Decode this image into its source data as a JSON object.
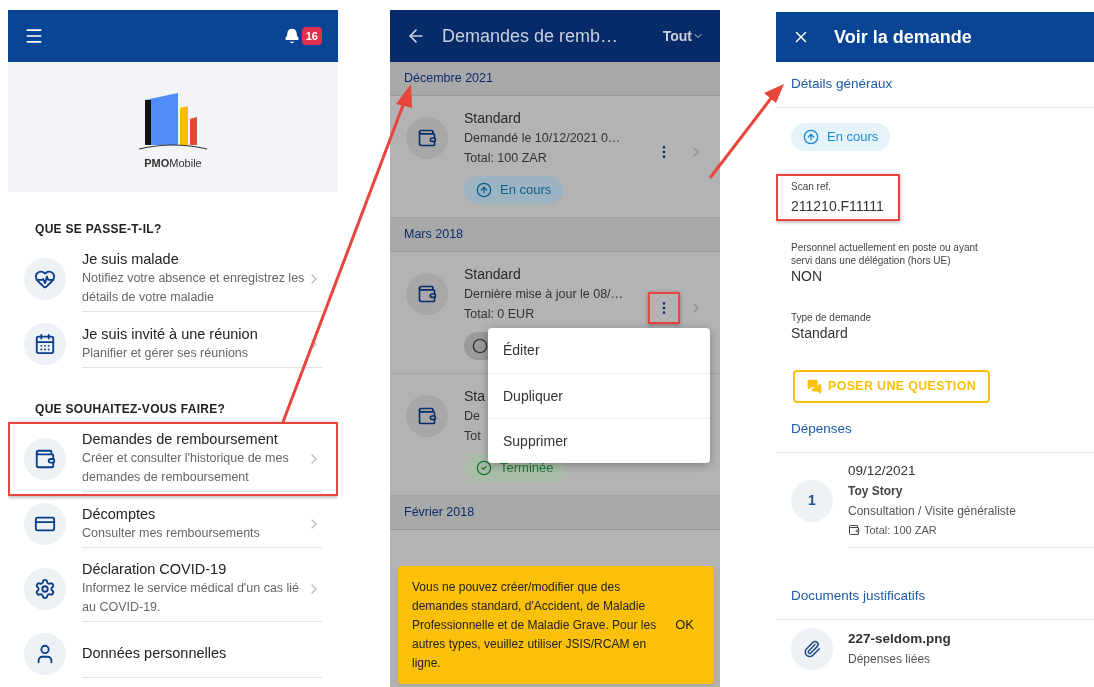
{
  "left_screen": {
    "notification_count": "16",
    "logo_bold": "PMO",
    "logo_light": "Mobile",
    "sections": [
      {
        "heading": "QUE SE PASSE-T-IL?",
        "items": [
          {
            "title": "Je suis malade",
            "subtitle": "Notifiez votre absence et enregistrez les détails de votre maladie",
            "highlighted": false
          },
          {
            "title": "Je suis invité à une réunion",
            "subtitle": "Planifier et gérer ses réunions",
            "highlighted": false
          }
        ]
      },
      {
        "heading": "QUE SOUHAITEZ-VOUS FAIRE?",
        "items": [
          {
            "title": "Demandes de remboursement",
            "subtitle": "Créer et consulter l'historique de mes demandes de remboursement",
            "highlighted": true
          },
          {
            "title": "Décomptes",
            "subtitle": "Consulter mes remboursements",
            "highlighted": false
          },
          {
            "title": "Déclaration COVID-19",
            "subtitle": "Informez le service médical d'un cas lié au COVID-19.",
            "highlighted": false
          },
          {
            "title": "Données personnelles",
            "highlighted": false
          }
        ]
      }
    ]
  },
  "middle_screen": {
    "title": "Demandes de remb…",
    "filter": "Tout",
    "groups": [
      {
        "month": "Décembre 2021",
        "cards": [
          {
            "title": "Standard",
            "line": "Demandé le 10/12/2021 0…",
            "total": "Total: 100 ZAR",
            "status": {
              "kind": "in_progress",
              "label": "En cours"
            },
            "actions": {
              "highlighted": false
            }
          }
        ]
      },
      {
        "month": "Mars 2018",
        "cards": [
          {
            "title": "Standard",
            "line": "Dernière mise à jour le 08/…",
            "total": "Total: 0 EUR",
            "status": {
              "kind": "draft"
            },
            "actions": {
              "highlighted": true
            }
          },
          {
            "title": "Sta",
            "line": "De",
            "total": "Tot",
            "status": {
              "kind": "done",
              "label": "Terminée"
            }
          }
        ]
      },
      {
        "month": "Février 2018"
      }
    ],
    "menu": [
      "Éditer",
      "Dupliquer",
      "Supprimer"
    ],
    "snackbar": {
      "message": "Vous ne pouvez créer/modifier que des demandes standard, d'Accident, de Maladie Professionnelle et de Maladie Grave. Pour les autres types, veuillez utiliser JSIS/RCAM en ligne.",
      "action": "OK"
    }
  },
  "right_screen": {
    "title": "Voir la demande",
    "general_heading": "Détails généraux",
    "status": {
      "kind": "in_progress",
      "label": "En cours"
    },
    "fields": [
      {
        "label": "Scan ref.",
        "value": "211210.F11111",
        "highlighted": true
      },
      {
        "label": "Personnel actuellement en poste ou ayant servi dans une délégation (hors UE)",
        "value": "NON",
        "highlighted": false
      },
      {
        "label": "Type de demande",
        "value": "Standard",
        "highlighted": false
      }
    ],
    "question_button": "POSER UNE QUESTION",
    "expenses_heading": "Dépenses",
    "expenses": [
      {
        "number": "1",
        "date": "09/12/2021",
        "name": "Toy Story",
        "category": "Consultation / Visite généraliste",
        "total": "Total: 100 ZAR"
      }
    ],
    "documents_heading": "Documents justificatifs",
    "documents": [
      {
        "name": "227-seldom.png",
        "subtitle": "Dépenses liées"
      }
    ]
  }
}
